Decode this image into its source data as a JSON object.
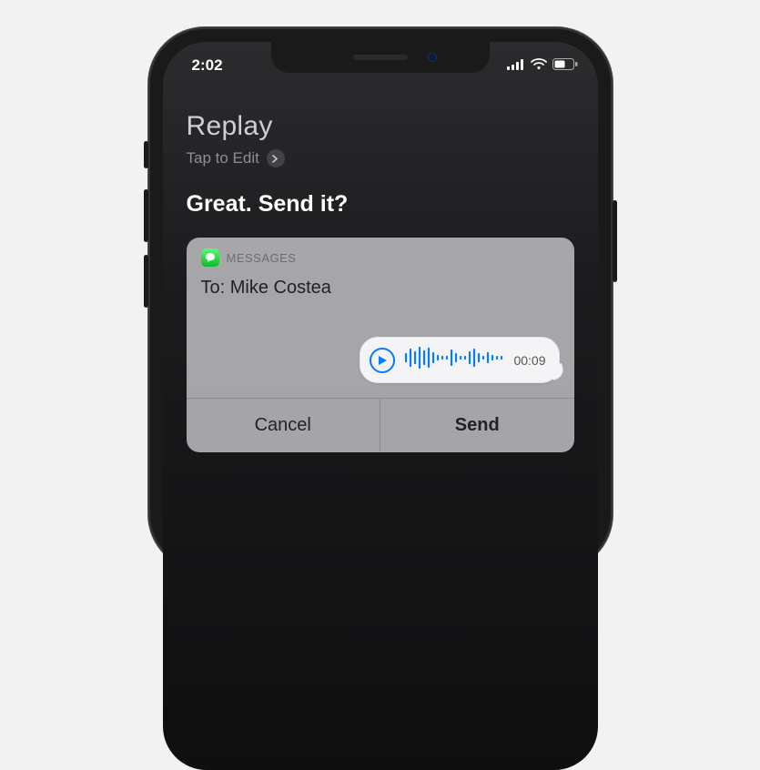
{
  "status": {
    "time": "2:02"
  },
  "siri": {
    "user_utterance": "Replay",
    "edit_hint": "Tap to Edit",
    "prompt": "Great. Send it?"
  },
  "card": {
    "app_label": "MESSAGES",
    "recipient_prefix": "To: ",
    "recipient_name": "Mike Costea",
    "audio_duration": "00:09",
    "actions": {
      "cancel": "Cancel",
      "send": "Send"
    }
  },
  "colors": {
    "accent_blue": "#0a7aff",
    "messages_green": "#34c759"
  }
}
